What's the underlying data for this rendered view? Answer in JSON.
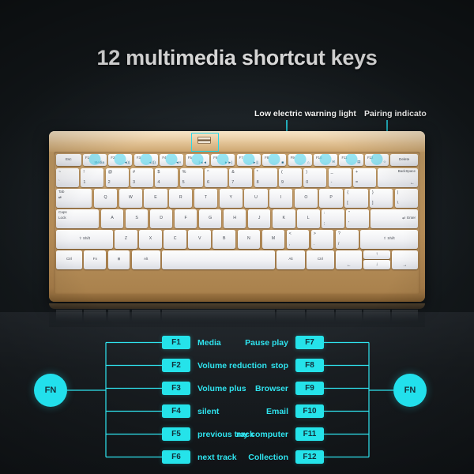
{
  "colors": {
    "background": "#13181b",
    "accent_cyan": "#25e3ea",
    "keyboard_gold": "#c19a63",
    "key_white": "#f0f1f4",
    "title_text": "#ffffff"
  },
  "title": "12 multimedia shortcut keys",
  "callouts": {
    "low_battery": "Low electric warning light",
    "pairing": "Pairing indicato"
  },
  "keyboard": {
    "function_row": [
      {
        "name": "Esc",
        "highlight": false,
        "icon": ""
      },
      {
        "name": "F1",
        "highlight": true,
        "icon": "Media"
      },
      {
        "name": "F2",
        "highlight": true,
        "icon": "◄))"
      },
      {
        "name": "F3",
        "highlight": true,
        "icon": "◄)))"
      },
      {
        "name": "F4",
        "highlight": true,
        "icon": "◄×"
      },
      {
        "name": "F5",
        "highlight": true,
        "icon": "|◄◄"
      },
      {
        "name": "F6",
        "highlight": true,
        "icon": "►►|"
      },
      {
        "name": "F7",
        "highlight": true,
        "icon": "►||"
      },
      {
        "name": "F8",
        "highlight": true,
        "icon": "■"
      },
      {
        "name": "F9",
        "highlight": true,
        "icon": "⌂"
      },
      {
        "name": "F10",
        "highlight": true,
        "icon": "✉"
      },
      {
        "name": "F11",
        "highlight": true,
        "icon": "▤"
      },
      {
        "name": "F12",
        "highlight": true,
        "icon": "☆"
      },
      {
        "name": "Delete",
        "highlight": false,
        "icon": ""
      }
    ],
    "number_row": [
      {
        "upper": "~",
        "lower": "`"
      },
      {
        "upper": "!",
        "lower": "1"
      },
      {
        "upper": "@",
        "lower": "2"
      },
      {
        "upper": "#",
        "lower": "3"
      },
      {
        "upper": "$",
        "lower": "4"
      },
      {
        "upper": "%",
        "lower": "5"
      },
      {
        "upper": "^",
        "lower": "6"
      },
      {
        "upper": "&",
        "lower": "7"
      },
      {
        "upper": "*",
        "lower": "8"
      },
      {
        "upper": "(",
        "lower": "9"
      },
      {
        "upper": ")",
        "lower": "0"
      },
      {
        "upper": "_",
        "lower": "-"
      },
      {
        "upper": "+",
        "lower": "="
      }
    ],
    "backspace": "BackSpace",
    "backspace_arrow": "←",
    "tab_label": "Tab",
    "tab_arrow": "⇄",
    "qwerty_row": [
      "Q",
      "W",
      "E",
      "R",
      "T",
      "Y",
      "U",
      "I",
      "O",
      "P"
    ],
    "qwerty_tail": [
      {
        "upper": "{",
        "lower": "["
      },
      {
        "upper": "}",
        "lower": "]"
      },
      {
        "upper": "|",
        "lower": "\\"
      }
    ],
    "caps_line1": "Caps",
    "caps_line2": "Lock",
    "home_row": [
      "A",
      "S",
      "D",
      "F",
      "G",
      "H",
      "J",
      "K",
      "L"
    ],
    "home_tail": [
      {
        "upper": ":",
        "lower": ";"
      },
      {
        "upper": "\"",
        "lower": "'"
      }
    ],
    "enter_label": "Enter",
    "enter_arrow": "↵",
    "shift_label": "Shift",
    "shift_arrow": "⇧",
    "bottom_alpha_row": [
      "Z",
      "X",
      "C",
      "V",
      "B",
      "N",
      "M"
    ],
    "bottom_alpha_tail": [
      {
        "upper": "<",
        "lower": ","
      },
      {
        "upper": ">",
        "lower": "."
      },
      {
        "upper": "?",
        "lower": "/"
      }
    ],
    "modifier_row": {
      "ctrl_left": "Ctrl",
      "fn": "Fn",
      "win": "⊞",
      "alt_left": "Alt",
      "space": "",
      "alt_right": "Alt",
      "ctrl_right": "Ctrl"
    },
    "arrows": {
      "left": "←",
      "up": "↑",
      "down": "↓",
      "right": "→"
    }
  },
  "diagram": {
    "fn_left_label": "FN",
    "fn_right_label": "FN",
    "left_column": [
      {
        "key": "F1",
        "label": "Media"
      },
      {
        "key": "F2",
        "label": "Volume reduction"
      },
      {
        "key": "F3",
        "label": "Volume plus"
      },
      {
        "key": "F4",
        "label": "silent"
      },
      {
        "key": "F5",
        "label": "previous track"
      },
      {
        "key": "F6",
        "label": "next track"
      }
    ],
    "right_column": [
      {
        "key": "F7",
        "label": "Pause play"
      },
      {
        "key": "F8",
        "label": "stop"
      },
      {
        "key": "F9",
        "label": "Browser"
      },
      {
        "key": "F10",
        "label": "Email"
      },
      {
        "key": "F11",
        "label": "my computer"
      },
      {
        "key": "F12",
        "label": "Collection"
      }
    ]
  }
}
